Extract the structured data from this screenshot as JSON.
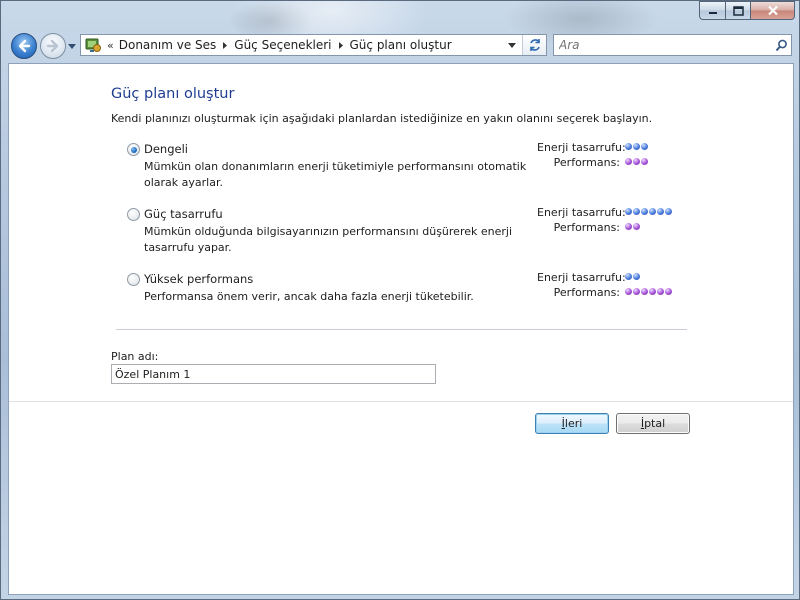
{
  "nav": {
    "breadcrumbs_overflow": "«",
    "breadcrumbs": [
      "Donanım ve Ses",
      "Güç Seçenekleri",
      "Güç planı oluştur"
    ],
    "search_placeholder": "Ara"
  },
  "page": {
    "title": "Güç planı oluştur",
    "intro": "Kendi planınızı oluşturmak için aşağıdaki planlardan istediğinize en yakın olanını seçerek başlayın."
  },
  "plans": [
    {
      "name": "Dengeli",
      "description": "Mümkün olan donanımların enerji tüketimiyle performansını otomatik olarak ayarlar.",
      "selected": true,
      "energy_label": "Enerji tasarrufu:",
      "performance_label": "Performans:",
      "energy_dots": 3,
      "performance_dots": 3
    },
    {
      "name": "Güç tasarrufu",
      "description": "Mümkün olduğunda bilgisayarınızın performansını düşürerek enerji tasarrufu yapar.",
      "selected": false,
      "energy_label": "Enerji tasarrufu:",
      "performance_label": "Performans:",
      "energy_dots": 6,
      "performance_dots": 2
    },
    {
      "name": "Yüksek performans",
      "description": "Performansa önem verir, ancak daha fazla enerji tüketebilir.",
      "selected": false,
      "energy_label": "Enerji tasarrufu:",
      "performance_label": "Performans:",
      "energy_dots": 2,
      "performance_dots": 6
    }
  ],
  "form": {
    "plan_name_label": "Plan adı:",
    "plan_name_value": "Özel Planım 1"
  },
  "buttons": {
    "next": "İleri",
    "cancel": "İptal"
  },
  "colors": {
    "title": "#1f3e92",
    "energy_dot": "#4a7bd9",
    "performance_dot": "#a455d6"
  }
}
